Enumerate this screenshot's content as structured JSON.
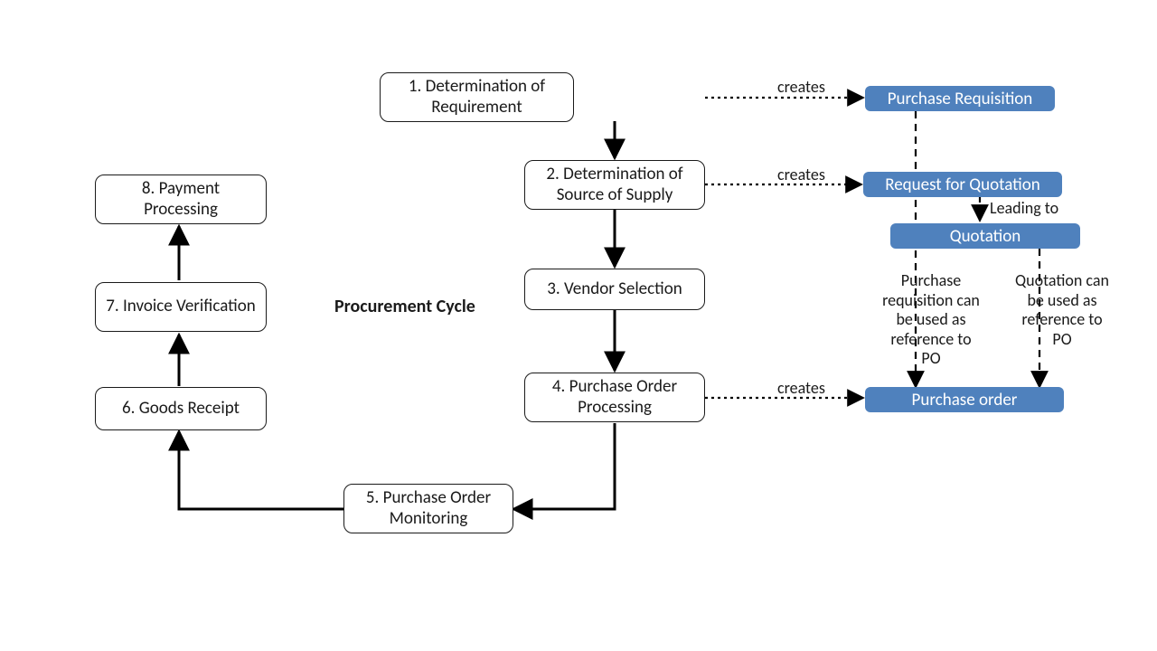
{
  "title": "Procurement Cycle",
  "steps": {
    "s1": "1. Determination of Requirement",
    "s2": "2. Determination of Source of Supply",
    "s3": "3. Vendor Selection",
    "s4": "4. Purchase Order Processing",
    "s5": "5. Purchase Order Monitoring",
    "s6": "6. Goods Receipt",
    "s7": "7. Invoice Verification",
    "s8": "8. Payment Processing"
  },
  "artifacts": {
    "pr": "Purchase Requisition",
    "rfq": "Request for Quotation",
    "quo": "Quotation",
    "po": "Purchase order"
  },
  "edge_labels": {
    "creates1": "creates",
    "creates2": "creates",
    "creates4": "creates",
    "leading_to": "Leading   to"
  },
  "notes": {
    "pr_ref": "Purchase requisition can be used as reference to PO",
    "quo_ref": "Quotation can be used as reference to PO"
  }
}
